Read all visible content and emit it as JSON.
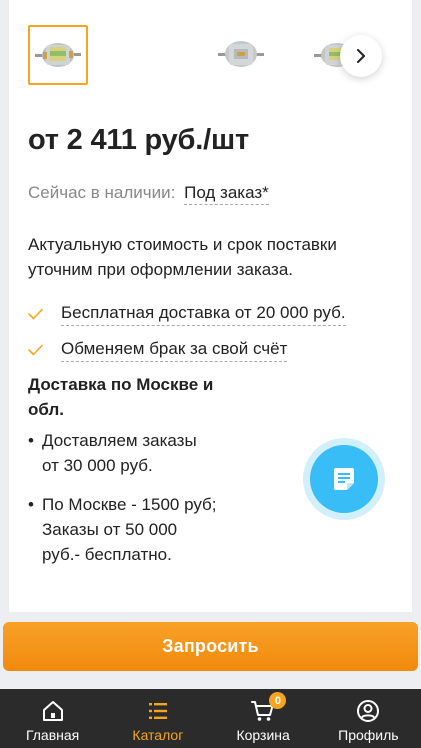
{
  "product": {
    "thumbnails": [
      {
        "icon": "fuel-filter-image",
        "selected": true
      },
      {
        "icon": "fuel-filter-image",
        "selected": false
      },
      {
        "icon": "fuel-filter-image",
        "selected": false
      }
    ],
    "next_icon": "chevron-right-icon",
    "price": "от 2 411 руб./шт",
    "availability_label": "Сейчас в наличии:",
    "availability_value": "Под заказ*",
    "notice": "Актуальную стоимость и срок поставки уточним при оформлении заказа.",
    "benefits": [
      "Бесплатная доставка от 20 000 руб.",
      "Обменяем брак за свой счёт"
    ],
    "delivery_title": "Доставка по Москве и обл.",
    "delivery_items": [
      "Доставляем заказы от 30 000 руб.",
      "По Москве - 1500 руб; Заказы от 50 000 руб.- бесплатно."
    ]
  },
  "chat_fab_icon": "chat-document-icon",
  "request_button": "Запросить",
  "tabbar": {
    "items": [
      {
        "label": "Главная",
        "icon": "home-icon",
        "active": false
      },
      {
        "label": "Каталог",
        "icon": "catalog-list-icon",
        "active": true
      },
      {
        "label": "Корзина",
        "icon": "cart-icon",
        "active": false,
        "badge": "0"
      },
      {
        "label": "Профиль",
        "icon": "profile-icon",
        "active": false
      }
    ]
  },
  "colors": {
    "accent": "#f7a521",
    "button": "#f18a0c",
    "fab": "#39bdf6",
    "tabbar": "#2b2b2b"
  }
}
